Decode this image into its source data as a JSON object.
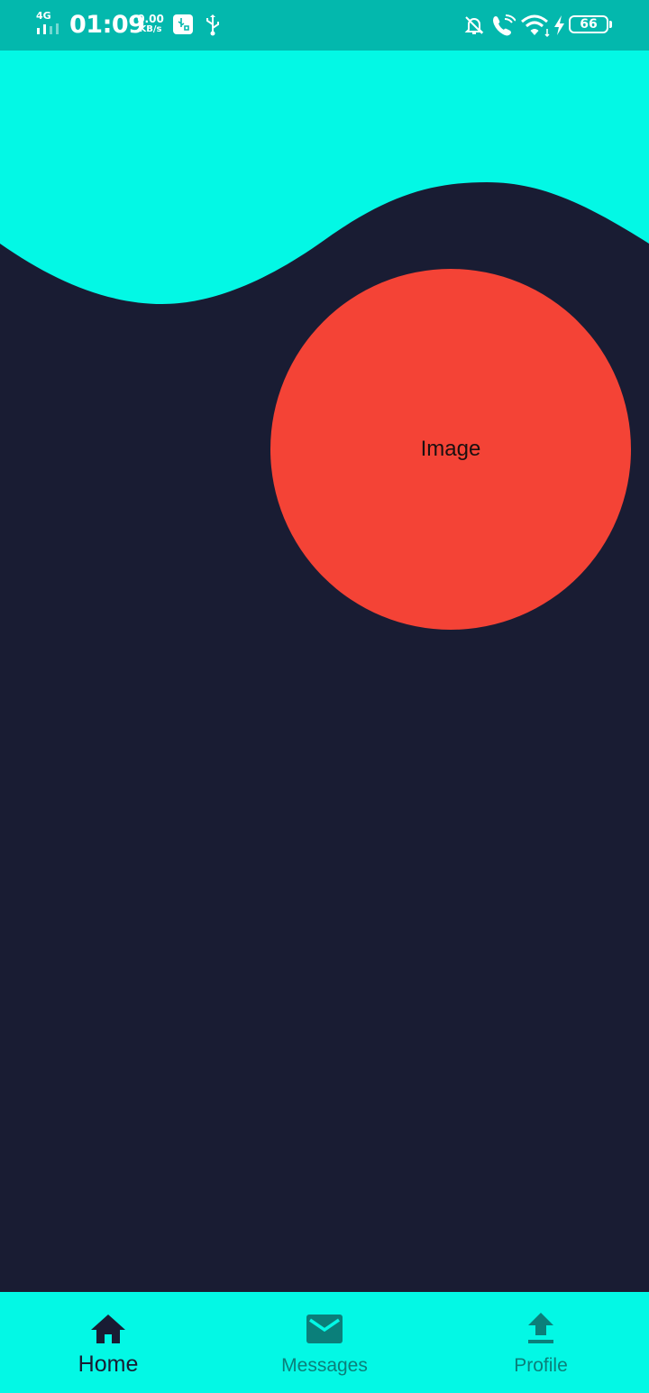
{
  "status_bar": {
    "network": "4G",
    "time": "01:09",
    "speed_value": "0.00",
    "speed_unit": "KB/s",
    "battery": "66",
    "icons": [
      "signal-icon",
      "usb-debug-icon",
      "usb-icon",
      "mute-bell-icon",
      "wifi-call-icon",
      "wifi-icon",
      "charging-icon",
      "battery-icon"
    ]
  },
  "colors": {
    "status_bar": "#03b8ad",
    "accent": "#03f8e5",
    "background": "#191c33",
    "circle": "#f44336"
  },
  "main": {
    "image_placeholder": "Image"
  },
  "bottom_nav": {
    "items": [
      {
        "label": "Home",
        "icon": "home-icon",
        "active": true
      },
      {
        "label": "Messages",
        "icon": "mail-icon",
        "active": false
      },
      {
        "label": "Profile",
        "icon": "upload-icon",
        "active": false
      }
    ]
  }
}
